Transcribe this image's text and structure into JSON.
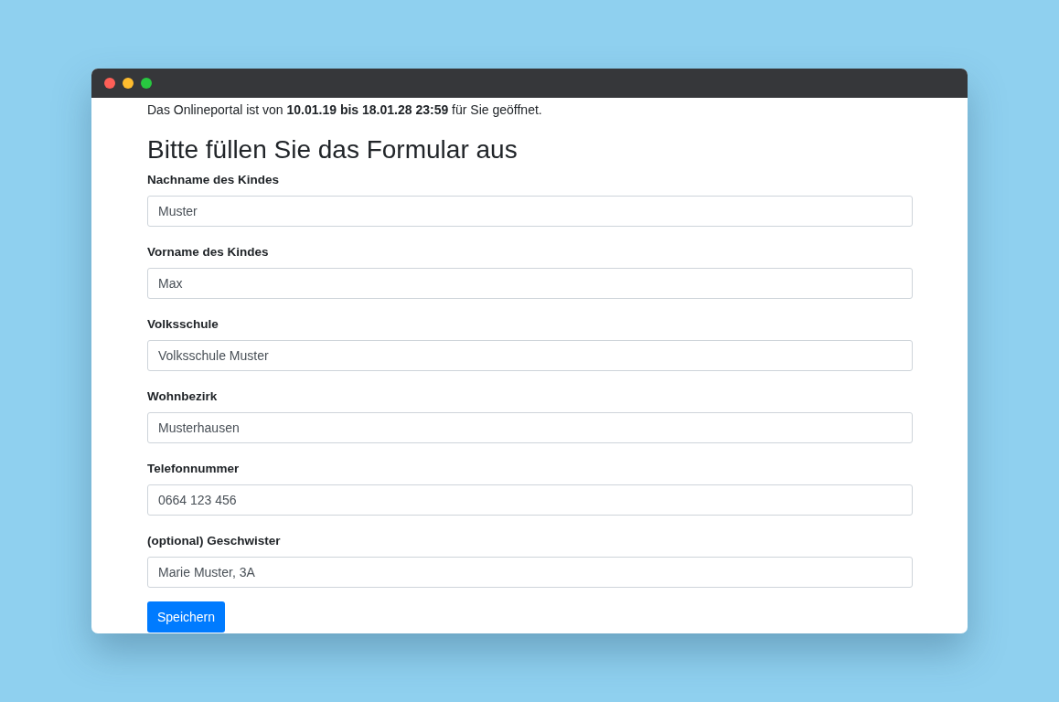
{
  "notice": "Das Onlineportal ist von **10.01.19 bis 18.01.28 23:59** für Sie geöffnet.",
  "heading": "Bitte füllen Sie das Formular aus",
  "fields": [
    {
      "label": "Nachname des Kindes",
      "value": "Muster"
    },
    {
      "label": "Vorname des Kindes",
      "value": "Max"
    },
    {
      "label": "Volksschule",
      "value": "Volksschule Muster"
    },
    {
      "label": "Wohnbezirk",
      "value": "Musterhausen"
    },
    {
      "label": "Telefonnummer",
      "value": "0664 123 456"
    },
    {
      "label": "(optional) Geschwister",
      "value": "Marie Muster, 3A"
    }
  ],
  "button": "Speichern"
}
